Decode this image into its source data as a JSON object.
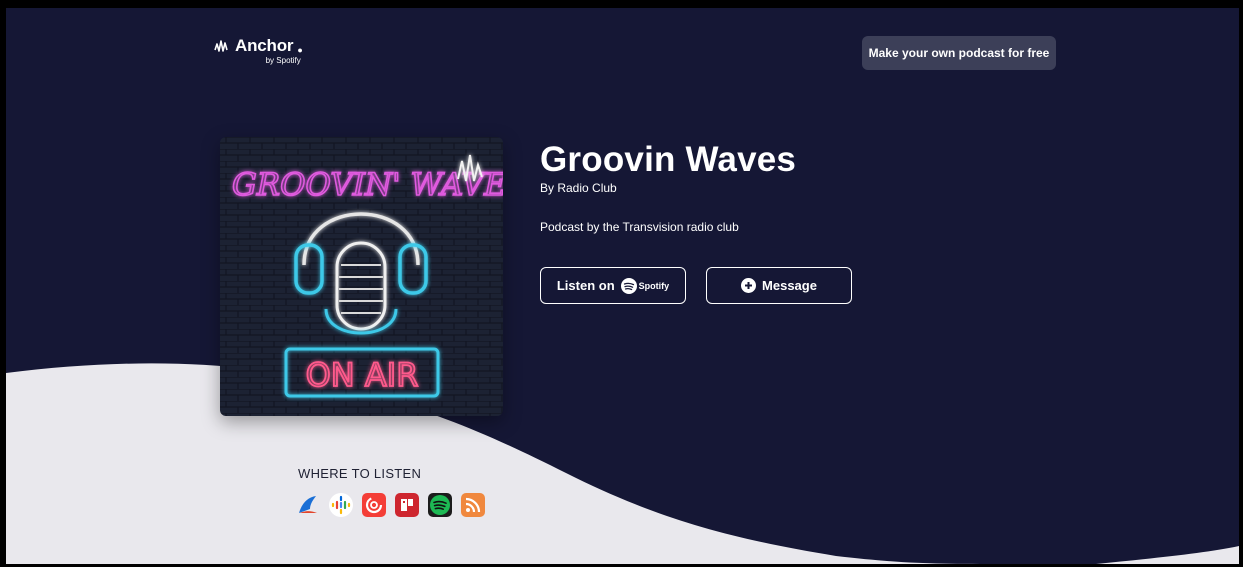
{
  "brand": {
    "name": "Anchor",
    "sub": "by Spotify"
  },
  "header": {
    "cta_label": "Make your own podcast for free"
  },
  "podcast": {
    "cover_title": "GROOVIN' WAVE",
    "cover_sign": "ON AIR",
    "title": "Groovin Waves",
    "author": "By Radio Club",
    "description": "Podcast by the Transvision radio club"
  },
  "actions": {
    "listen_label": "Listen on",
    "spotify_wordmark": "Spotify",
    "message_label": "Message"
  },
  "where_to_listen": {
    "heading": "WHERE TO LISTEN",
    "platforms": [
      {
        "name": "breaker-icon",
        "color": "#1a6fd6"
      },
      {
        "name": "google-podcasts-icon",
        "color": "#ffffff"
      },
      {
        "name": "pocket-casts-icon",
        "color": "#f43e37"
      },
      {
        "name": "radiopublic-icon",
        "color": "#ce262f"
      },
      {
        "name": "spotify-icon",
        "color": "#1db954"
      },
      {
        "name": "rss-icon",
        "color": "#f0883e"
      }
    ]
  },
  "colors": {
    "background": "#151735",
    "wave": "#e9e8ed",
    "cta_bg": "#3c3f58"
  }
}
